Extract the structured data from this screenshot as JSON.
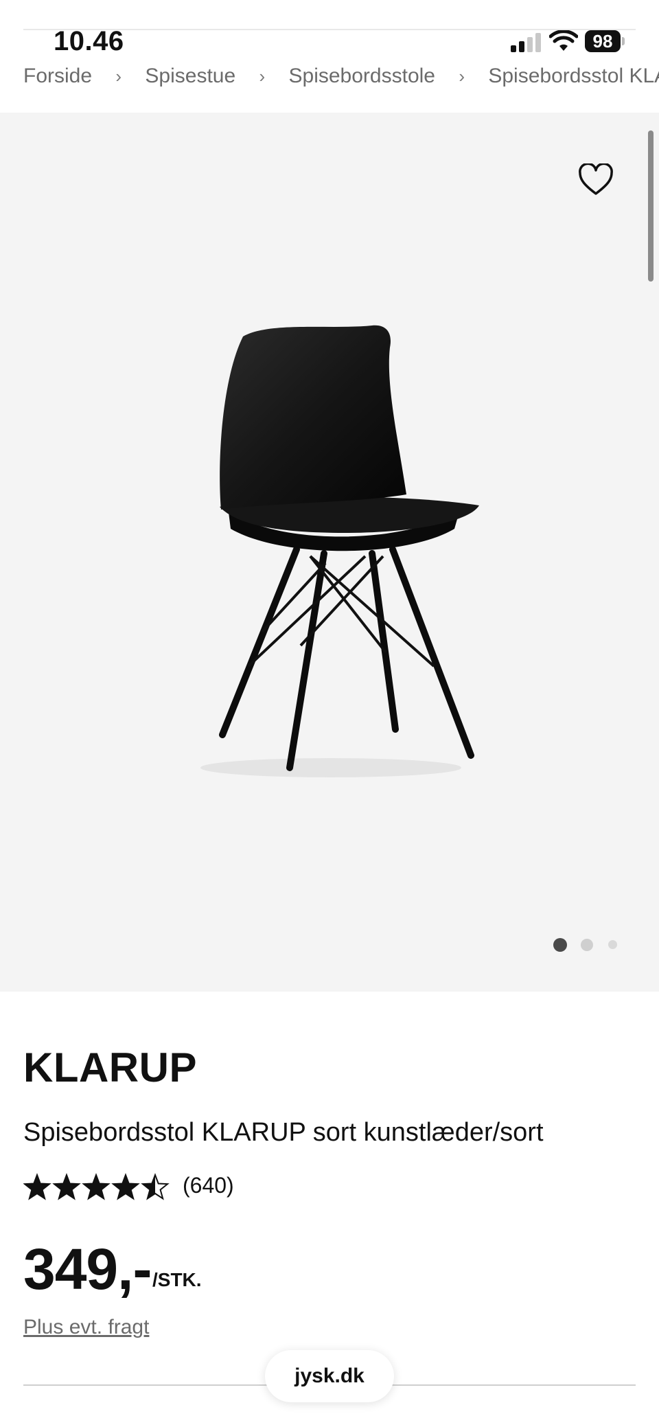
{
  "status_bar": {
    "time": "10.46",
    "battery": "98"
  },
  "breadcrumb": {
    "items": [
      "Forside",
      "Spisestue",
      "Spisebordsstole",
      "Spisebordsstol KLA"
    ],
    "separator": "›"
  },
  "gallery": {
    "favorite_icon": "heart-outline-icon",
    "image_count": 3,
    "active_index": 0,
    "image_alt": "chair"
  },
  "product": {
    "name": "KLARUP",
    "description": "Spisebordsstol KLARUP sort kunstlæder/sort",
    "rating_value": 4.5,
    "rating_max": 5,
    "rating_count": "(640)",
    "price": "349,-",
    "unit": "/STK.",
    "freight_link": "Plus evt. fragt"
  },
  "browser": {
    "url": "jysk.dk"
  },
  "colors": {
    "text": "#111111",
    "muted": "#6b6b6b",
    "gallery_bg": "#f4f4f4"
  }
}
